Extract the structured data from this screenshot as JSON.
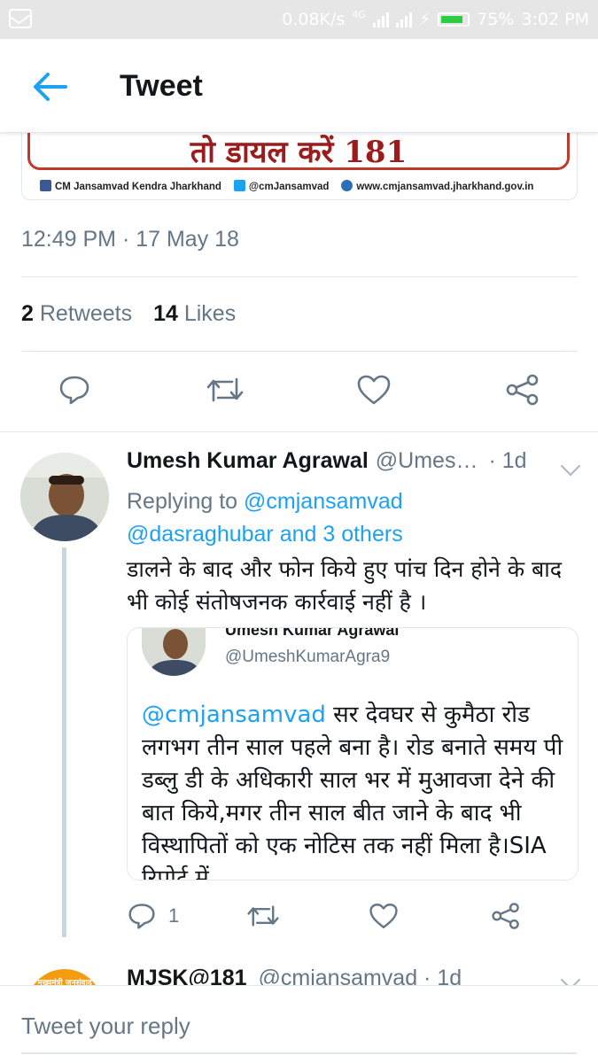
{
  "status_bar": {
    "speed": "0.08K/s",
    "network": "4G",
    "battery": "75%",
    "time": "3:02 PM"
  },
  "header": {
    "title": "Tweet"
  },
  "media": {
    "hindi_text": "तो डायल करें 181",
    "facebook": "CM Jansamvad Kendra Jharkhand",
    "twitter": "@cmJansamvad",
    "website": "www.cmjansamvad.jharkhand.gov.in"
  },
  "tweet": {
    "timestamp": "12:49 PM · 17 May 18",
    "retweets_count": "2",
    "retweets_label": "Retweets",
    "likes_count": "14",
    "likes_label": "Likes"
  },
  "reply": {
    "name": "Umesh Kumar Agrawal",
    "handle": "@Umes…",
    "time": "· 1d",
    "replying_prefix": "Replying to",
    "replying_to": "@cmjansamvad",
    "replying_more": "@dasraghubar and 3 others",
    "text": "डालने के बाद और फोन किये हुए पांच दिन होने के बाद भी कोई संतोषजनक कार्रवाई नहीं है ।",
    "reply_count": "1",
    "quote": {
      "name": "Umesh Kumar Agrawal",
      "handle": "@UmeshKumarAgra9",
      "mention": "@cmjansamvad",
      "text": " सर देवघर से कुमैठा रोड लगभग तीन साल पहले बना है। रोड बनाते समय पी डब्लु डी के अधिकारी साल भर में मुआवजा देने की बात किये,मगर तीन साल बीत जाने के बाद भी विस्थापितों को एक नोटिस तक नहीं मिला है।SIA रिपोर्ट में"
    }
  },
  "next_reply": {
    "name": "MJSK@181",
    "handle": "@cmjansamvad · 1d",
    "avatar_text": "मुख्यमंत्री जनसंवाद"
  },
  "compose": {
    "placeholder": "Tweet your reply"
  },
  "colors": {
    "accent": "#1da1f2",
    "muted": "#657786",
    "text": "#14171a",
    "divider": "#e1e8ed"
  }
}
